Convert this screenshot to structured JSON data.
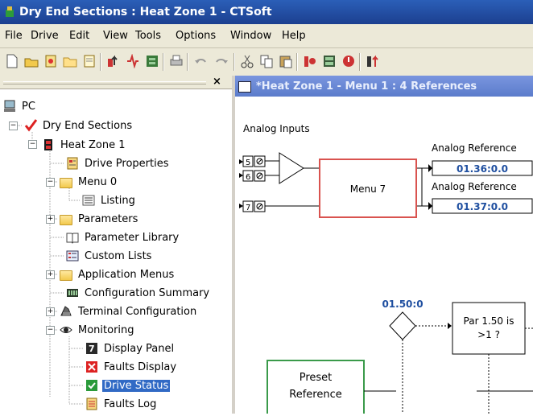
{
  "window": {
    "title": "Dry End Sections : Heat Zone 1 - CTSoft"
  },
  "menu": [
    "File",
    "Drive",
    "Edit",
    "View",
    "Tools",
    "Options",
    "Window",
    "Help"
  ],
  "tree_pane": {
    "close_glyph": "×"
  },
  "tree": {
    "root": "PC",
    "project": "Dry End Sections",
    "drive": "Heat Zone 1",
    "drive_properties": "Drive Properties",
    "menu0": "Menu 0",
    "listing": "Listing",
    "parameters": "Parameters",
    "parameter_library": "Parameter Library",
    "custom_lists": "Custom Lists",
    "application_menus": "Application Menus",
    "configuration_summary": "Configuration Summary",
    "terminal_configuration": "Terminal Configuration",
    "monitoring": "Monitoring",
    "display_panel": "Display Panel",
    "faults_display": "Faults Display",
    "drive_status": "Drive Status",
    "faults_log": "Faults Log"
  },
  "document": {
    "title": "*Heat Zone 1 - Menu 1 : 4 References",
    "analog_inputs_label": "Analog Inputs",
    "terminal_5": "5",
    "terminal_6": "6",
    "terminal_7": "7",
    "menu7_label": "Menu 7",
    "analog_ref_1_label": "Analog Reference",
    "analog_ref_1_value": "01.36:0.0",
    "analog_ref_2_label": "Analog Reference",
    "analog_ref_2_value": "01.37:0.0",
    "param_150": "01.50:0",
    "par_check_line1": "Par 1.50 is",
    "par_check_line2": ">1 ?",
    "preset_line1": "Preset",
    "preset_line2": "Reference"
  },
  "colors": {
    "title_blue": "#1c3f8f",
    "menu7_border": "#d9534f",
    "preset_border": "#3a9a4a",
    "value_blue": "#1f4fa0"
  }
}
